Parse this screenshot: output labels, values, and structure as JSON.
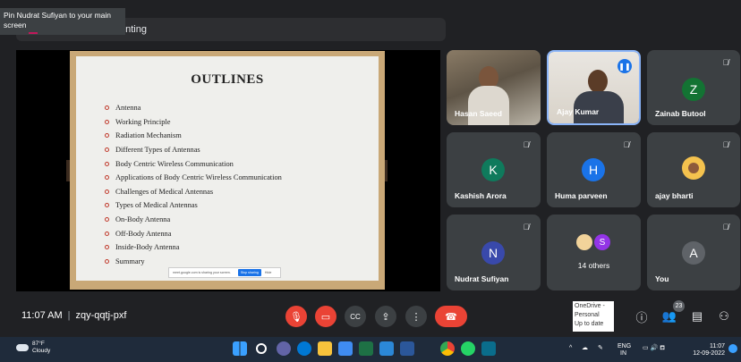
{
  "top_bar": {
    "tooltip": "Pin Nudrat Sufiyan to your main screen",
    "presenting_label": "enting"
  },
  "slide": {
    "title": "OUTLINES",
    "items": [
      "Antenna",
      "Working Principle",
      "Radiation Mechanism",
      "Different Types of Antennas",
      "Body Centric Wireless Communication",
      "Applications of Body Centric Wireless Communication",
      "Challenges of Medical Antennas",
      "Types of Medical Antennas",
      "On-Body Antenna",
      "Off-Body Antenna",
      "Inside-Body Antenna",
      "Summary"
    ],
    "share_banner": {
      "text": "meet.google.com is sharing your screen.",
      "stop_label": "Stop sharing",
      "hide_label": "Hide"
    }
  },
  "participants": {
    "hasan": "Hasan Saeed",
    "ajay_kumar": "Ajay Kumar",
    "zainab": "Zainab Butool",
    "zainab_initial": "Z",
    "kashish": "Kashish Arora",
    "kashish_initial": "K",
    "huma": "Huma parveen",
    "huma_initial": "H",
    "ajay_bharti": "ajay bharti",
    "nudrat": "Nudrat Sufiyan",
    "nudrat_initial": "N",
    "others": "14 others",
    "others_initial": "S",
    "you": "You",
    "you_initial": "A"
  },
  "colors": {
    "zainab": "#137333",
    "kashish": "#0f7a5c",
    "huma": "#1a73e8",
    "nudrat": "#3949ab",
    "others": "#9334e6",
    "you": "#5f6368",
    "end_call": "#ea4335"
  },
  "controls": {
    "time": "11:07 AM",
    "meeting_code": "zqy-qqtj-pxf",
    "people_count": "23",
    "icons": [
      "mic-off-icon",
      "camera-off-icon",
      "captions-icon",
      "present-icon",
      "more-icon",
      "end-call-icon",
      "info-icon",
      "people-icon",
      "chat-icon",
      "activities-icon"
    ]
  },
  "onedrive": {
    "line1": "OneDrive -",
    "line2": "Personal",
    "line3": "Up to date"
  },
  "taskbar": {
    "temperature": "87°F",
    "condition": "Cloudy",
    "lang_line1": "ENG",
    "lang_line2": "IN",
    "time": "11:07",
    "date": "12-09-2022"
  }
}
